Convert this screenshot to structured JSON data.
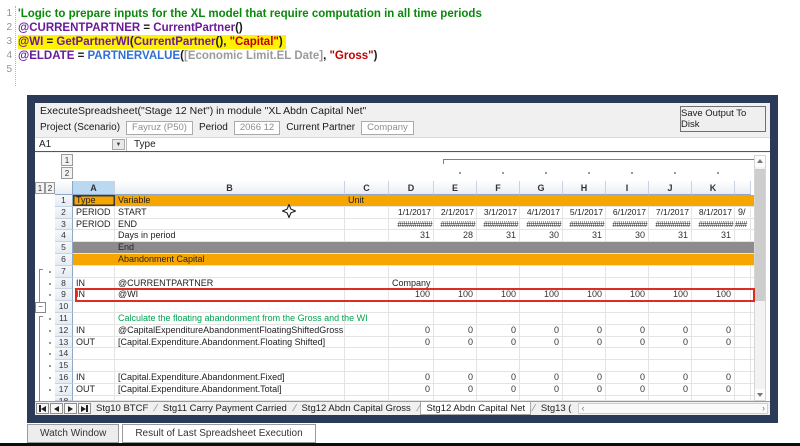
{
  "colors": {
    "window_border": "#2b3a57",
    "band_orange": "#f7a600",
    "band_gray": "#8c8c8c",
    "highlight_red": "#e02b20",
    "selection_blue": "#b9d9f2",
    "code_highlight": "#fff200",
    "green_text": "#00a550"
  },
  "code_editor": {
    "lines": [
      {
        "n": "1",
        "hl": false,
        "segments": [
          {
            "t": "'Logic to prepare inputs for the XL model that require computation in all time periods",
            "c": "comment"
          }
        ]
      },
      {
        "n": "2",
        "hl": false,
        "segments": [
          {
            "t": "@CURRENTPARTNER",
            "c": "var"
          },
          {
            "t": " = ",
            "c": "plain"
          },
          {
            "t": "CurrentPartner",
            "c": "func"
          },
          {
            "t": "()",
            "c": "plain"
          }
        ]
      },
      {
        "n": "3",
        "hl": true,
        "segments": [
          {
            "t": "@WI",
            "c": "var"
          },
          {
            "t": " = ",
            "c": "plain"
          },
          {
            "t": "GetPartnerWI",
            "c": "func"
          },
          {
            "t": "(",
            "c": "plain"
          },
          {
            "t": "CurrentPartner",
            "c": "func"
          },
          {
            "t": "(), ",
            "c": "plain"
          },
          {
            "t": "\"Capital\"",
            "c": "string"
          },
          {
            "t": ")",
            "c": "plain"
          }
        ]
      },
      {
        "n": "4",
        "hl": false,
        "segments": [
          {
            "t": "@ELDATE",
            "c": "var"
          },
          {
            "t": " = ",
            "c": "plain"
          },
          {
            "t": "PARTNERVALUE",
            "c": "builtin"
          },
          {
            "t": "(",
            "c": "plain"
          },
          {
            "t": "[Economic Limit.EL Date]",
            "c": "ref"
          },
          {
            "t": ", ",
            "c": "plain"
          },
          {
            "t": "\"Gross\"",
            "c": "string"
          },
          {
            "t": ")",
            "c": "plain"
          }
        ]
      },
      {
        "n": "5",
        "hl": false,
        "segments": []
      }
    ]
  },
  "window": {
    "title": "ExecuteSpreadsheet(\"Stage 12 Net\") in module \"XL Abdn Capital Net\"",
    "save_button": "Save Output To Disk",
    "fields": [
      {
        "label": "Project (Scenario)",
        "value": "Fayruz (P50)"
      },
      {
        "label": "Period",
        "value": "2066 12"
      },
      {
        "label": "Current Partner",
        "value": "Company"
      }
    ],
    "name_box": "A1",
    "formula_value": "Type"
  },
  "sheet": {
    "columns": [
      "A",
      "B",
      "C",
      "D",
      "E",
      "F",
      "G",
      "H",
      "I",
      "J",
      "K"
    ],
    "outline_col_buttons": [
      "1",
      "2"
    ],
    "outline_row_buttons": [
      "1",
      "2"
    ],
    "rows": [
      {
        "n": "1",
        "band": "orange",
        "a": "Type",
        "b": "Variable",
        "c": "Unit",
        "sel": "a"
      },
      {
        "n": "2",
        "a": "PERIOD",
        "b": "START",
        "vals": [
          "1/1/2017",
          "2/1/2017",
          "3/1/2017",
          "4/1/2017",
          "5/1/2017",
          "6/1/2017",
          "7/1/2017",
          "8/1/2017"
        ],
        "vfmt": "date",
        "partial": "9/"
      },
      {
        "n": "3",
        "a": "PERIOD",
        "b": "END",
        "vals": [
          "#########",
          "#########",
          "#########",
          "#########",
          "#########",
          "#########",
          "#########",
          "#########"
        ],
        "vfmt": "hashes",
        "partial": "###"
      },
      {
        "n": "4",
        "b": "Days in period",
        "vals": [
          "31",
          "28",
          "31",
          "30",
          "31",
          "30",
          "31",
          "31"
        ],
        "vfmt": "num"
      },
      {
        "n": "5",
        "band": "gray",
        "b": "End"
      },
      {
        "n": "6",
        "band": "orange",
        "b": "Abandonment Capital"
      },
      {
        "n": "7",
        "g1": "start",
        "g2": "dot"
      },
      {
        "n": "8",
        "a": "IN",
        "b": "@CURRENTPARTNER",
        "d": "Company",
        "g1": "mid",
        "g2": "dot"
      },
      {
        "n": "9",
        "a": "IN",
        "b": "@WI",
        "vals": [
          "100",
          "100",
          "100",
          "100",
          "100",
          "100",
          "100",
          "100"
        ],
        "vfmt": "num",
        "redbox": true,
        "g1": "mid",
        "g2": "dot"
      },
      {
        "n": "10",
        "g1": "minus"
      },
      {
        "n": "11",
        "b": "Calculate the floating abandonment from the Gross and the WI",
        "bGreen": true,
        "g1": "start",
        "g2": "dot"
      },
      {
        "n": "12",
        "a": "IN",
        "b": "@CapitalExpenditureAbandonmentFloatingShiftedGross",
        "vals": [
          "0",
          "0",
          "0",
          "0",
          "0",
          "0",
          "0",
          "0"
        ],
        "vfmt": "num",
        "g1": "mid",
        "g2": "dot"
      },
      {
        "n": "13",
        "a": "OUT",
        "b": "[Capital.Expenditure.Abandonment.Floating Shifted]",
        "vals": [
          "0",
          "0",
          "0",
          "0",
          "0",
          "0",
          "0",
          "0"
        ],
        "vfmt": "num",
        "g1": "mid",
        "g2": "dot"
      },
      {
        "n": "14",
        "g1": "mid",
        "g2": "dot"
      },
      {
        "n": "15",
        "g1": "mid",
        "g2": "dot"
      },
      {
        "n": "16",
        "a": "IN",
        "b": "[Capital.Expenditure.Abandonment.Fixed]",
        "vals": [
          "0",
          "0",
          "0",
          "0",
          "0",
          "0",
          "0",
          "0"
        ],
        "vfmt": "num",
        "g1": "mid",
        "g2": "dot"
      },
      {
        "n": "17",
        "a": "OUT",
        "b": "[Capital.Expenditure.Abandonment.Total]",
        "vals": [
          "0",
          "0",
          "0",
          "0",
          "0",
          "0",
          "0",
          "0"
        ],
        "vfmt": "num",
        "g1": "mid",
        "g2": "dot"
      },
      {
        "n": "18",
        "partialRow": true,
        "g1": "mid",
        "g2": "dot"
      }
    ]
  },
  "sheet_tabs": {
    "tabs": [
      {
        "label": "Stg10 BTCF",
        "active": false
      },
      {
        "label": "Stg11 Carry Payment Carried",
        "active": false
      },
      {
        "label": "Stg12 Abdn Capital Gross",
        "active": false
      },
      {
        "label": "Stg12 Abdn Capital Net",
        "active": true
      },
      {
        "label": "Stg13 (",
        "active": false
      }
    ],
    "scroll_left": "‹",
    "scroll_right": "›"
  },
  "bottom_tabs": [
    {
      "label": "Watch Window"
    },
    {
      "label": "Result of Last Spreadsheet Execution"
    }
  ]
}
